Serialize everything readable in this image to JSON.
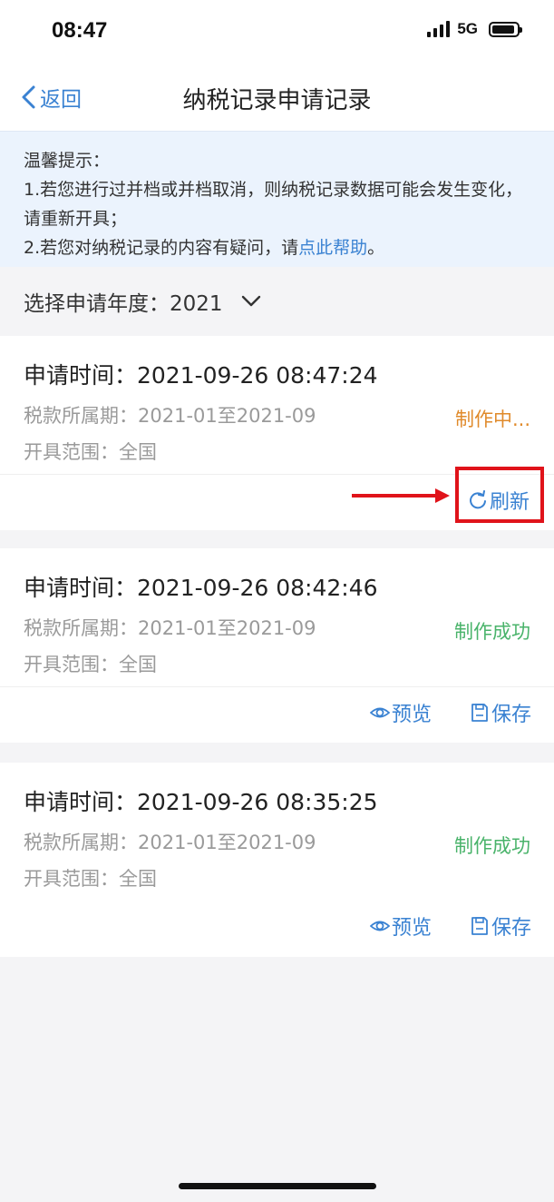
{
  "status_bar": {
    "time": "08:47",
    "network": "5G"
  },
  "nav": {
    "back_label": "返回",
    "title": "纳税记录申请记录"
  },
  "tip": {
    "heading": "温馨提示：",
    "line1": "1.若您进行过并档或并档取消，则纳税记录数据可能会发生变化，请重新开具；",
    "line2_prefix": "2.若您对纳税记录的内容有疑问，请",
    "line2_link": "点此帮助",
    "line2_suffix": "。"
  },
  "year_selector": {
    "label": "选择申请年度：2021"
  },
  "records": [
    {
      "time": "申请时间：2021-09-26 08:47:24",
      "period": "税款所属期：2021-01至2021-09",
      "scope": "开具范围：全国",
      "status": "制作中...",
      "refresh": "刷新"
    },
    {
      "time": "申请时间：2021-09-26 08:42:46",
      "period": "税款所属期：2021-01至2021-09",
      "scope": "开具范围：全国",
      "status": "制作成功",
      "preview": "预览",
      "save": "保存"
    },
    {
      "time": "申请时间：2021-09-26 08:35:25",
      "period": "税款所属期：2021-01至2021-09",
      "scope": "开具范围：全国",
      "status": "制作成功",
      "preview": "预览",
      "save": "保存"
    }
  ],
  "colors": {
    "accent": "#3a82d2",
    "making": "#e08a2a",
    "success": "#49b36a",
    "highlight": "#e0131a"
  }
}
